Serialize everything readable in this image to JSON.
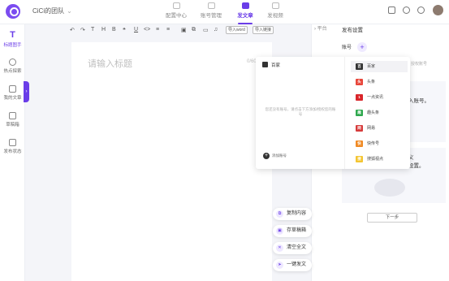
{
  "header": {
    "team_name": "CiCi的团队",
    "nav": [
      {
        "label": "配置中心",
        "active": false
      },
      {
        "label": "账号管理",
        "active": false
      },
      {
        "label": "发文章",
        "active": true
      },
      {
        "label": "发视频",
        "active": false
      }
    ]
  },
  "sidebar": {
    "items": [
      {
        "label": "标题图手",
        "icon": "T"
      },
      {
        "label": "热点探索",
        "icon": ""
      },
      {
        "label": "我的文章",
        "icon": ""
      },
      {
        "label": "草稿箱",
        "icon": ""
      },
      {
        "label": "发布状态",
        "icon": ""
      }
    ]
  },
  "toolbar": {
    "buttons": [
      "↶",
      "↷",
      "T",
      "H",
      "B",
      "❝",
      "U",
      "<>",
      "≡",
      "≡",
      "▣",
      "⧉",
      "▭",
      "♫"
    ],
    "import_word": "导入word",
    "import_link": "导入链接"
  },
  "editor": {
    "title_placeholder": "请输入标题",
    "title_count": "0/60"
  },
  "dropdown": {
    "header": "百家",
    "empty_text": "您还没有账号，请点击下方添加/授权您的账号",
    "add_account": "添加账号",
    "platforms": [
      {
        "label": "百家",
        "color": "#333333",
        "mark": "百",
        "selected": true
      },
      {
        "label": "头条",
        "color": "#e8463a",
        "mark": "头",
        "selected": false
      },
      {
        "label": "一点资讯",
        "color": "#d9262b",
        "mark": "1",
        "selected": false
      },
      {
        "label": "趣头条",
        "color": "#2fa84e",
        "mark": "趣",
        "selected": false
      },
      {
        "label": "网易",
        "color": "#d63b3b",
        "mark": "网",
        "selected": false
      },
      {
        "label": "快传号",
        "color": "#f08a24",
        "mark": "快",
        "selected": false
      },
      {
        "label": "搜狐视点",
        "color": "#f4c531",
        "mark": "搜",
        "selected": false
      }
    ]
  },
  "right_panel": {
    "tab": "平台",
    "title": "发布设置",
    "account_label": "账号",
    "hint": "授权账号",
    "step1_text": "入账号。",
    "step2_text_a": "义",
    "step2_text_b": "设置。",
    "next_button": "下一步"
  },
  "float_actions": [
    {
      "label": "复制内容"
    },
    {
      "label": "存草稿箱"
    },
    {
      "label": "清空全文"
    },
    {
      "label": "一键发文"
    }
  ],
  "colors": {
    "accent": "#6a3de8"
  }
}
